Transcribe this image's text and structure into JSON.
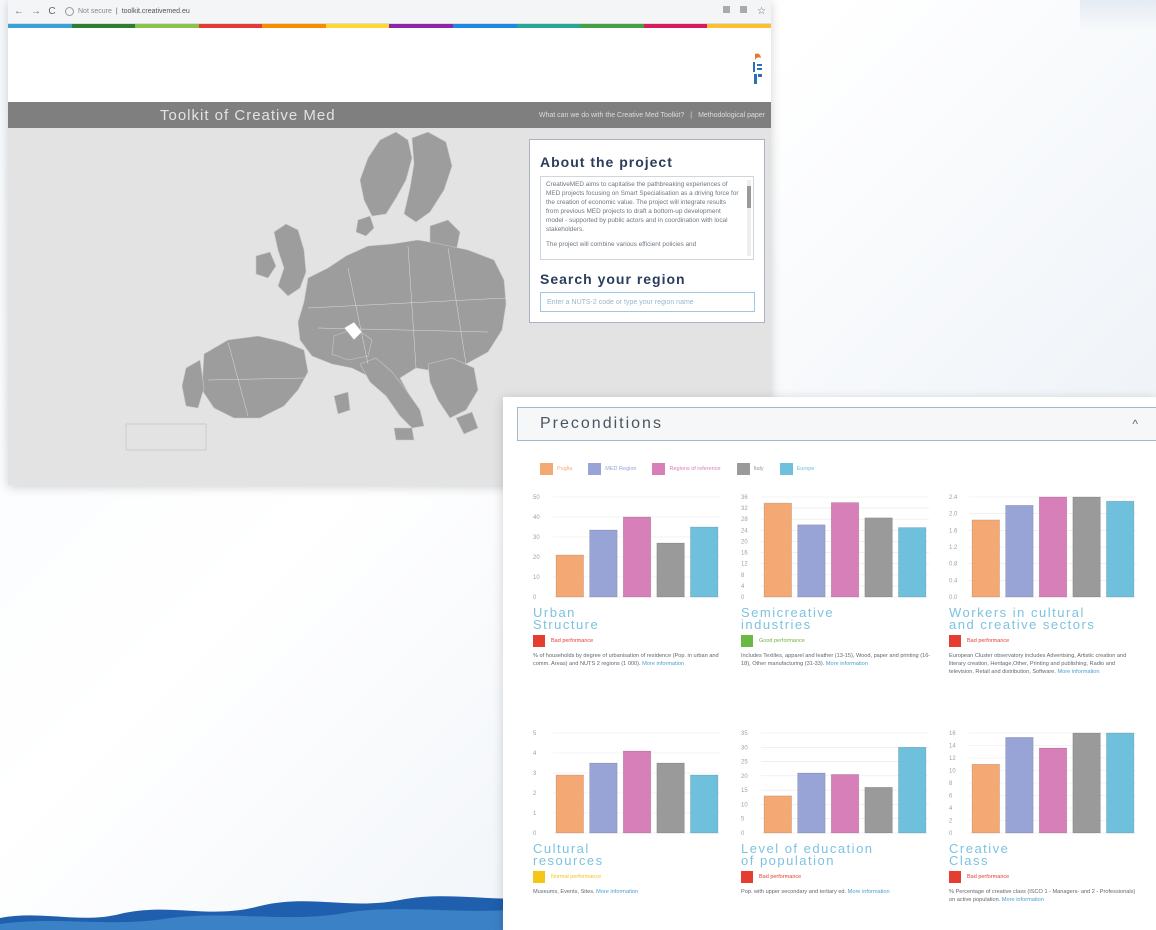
{
  "browser": {
    "security_label": "Not secure",
    "url": "toolkit.creativemed.eu",
    "rainbow_colors": [
      "#3aa0d8",
      "#2e7d32",
      "#8bc34a",
      "#e53935",
      "#fb8c00",
      "#fdd835",
      "#8e24aa",
      "#1e88e5",
      "#26a69a",
      "#43a047",
      "#d81b60",
      "#fbc02d"
    ]
  },
  "site": {
    "title": "Toolkit of Creative Med",
    "nav_items": [
      "What can we do with the Creative Med Toolkit?",
      "Methodological paper"
    ]
  },
  "about": {
    "title": "About the project",
    "text_1": "CreativeMED aims to capitalise the pathbreaking experiences of MED projects focusing on Smart Specialisation as a driving force for the creation of economic value. The project will integrate results from previous MED projects to draft a bottom-up development model - supported by public actors and in coordination with local stakeholders.",
    "text_2": "The project will combine various efficient policies and"
  },
  "search": {
    "title": "Search your region",
    "placeholder": "Enter a NUTS-2 code or type your region name"
  },
  "preconditions": {
    "title": "Preconditions",
    "chevron": "^",
    "legend": [
      {
        "label": "Puglia",
        "color": "#f4a874"
      },
      {
        "label": "MED Region",
        "color": "#98a3d6"
      },
      {
        "label": "Regions of reference",
        "color": "#d77fb9"
      },
      {
        "label": "Italy",
        "color": "#9a9a9a"
      },
      {
        "label": "Europe",
        "color": "#6fc0dc"
      }
    ],
    "performance_colors": {
      "bad": "#e53d30",
      "good": "#6bb844",
      "normal": "#f5c518"
    }
  },
  "chart_data": [
    {
      "type": "bar",
      "title_1": "Urban",
      "title_2": "Structure",
      "categories": [
        "Puglia",
        "MED Region",
        "Regions of reference",
        "Italy",
        "Europe"
      ],
      "values": [
        21,
        33.5,
        40,
        27,
        35
      ],
      "ylim": [
        0,
        50
      ],
      "yticks": [
        "0",
        "10",
        "20",
        "30",
        "40",
        "50"
      ],
      "performance": "Bad performance",
      "performance_level": "bad",
      "description": "% of households by degree of urbanisation of residence (Pop. in urban and comm. Areas) and NUTS 2 regions (1 000).",
      "more": "More information"
    },
    {
      "type": "bar",
      "title_1": "Semicreative",
      "title_2": "industries",
      "categories": [
        "Puglia",
        "MED Region",
        "Regions of reference",
        "Italy",
        "Europe"
      ],
      "values": [
        33.8,
        26,
        34,
        28.5,
        25
      ],
      "ylim": [
        0,
        36
      ],
      "yticks": [
        "0",
        "4",
        "8",
        "12",
        "16",
        "20",
        "24",
        "28",
        "32",
        "36"
      ],
      "performance": "Good performance",
      "performance_level": "good",
      "description": "Includes Textiles, apparel and leather (13-15), Wood, paper and printing (16-18), Other manufacturing (31-33).",
      "more": "More information"
    },
    {
      "type": "bar",
      "title_1": "Workers in cultural",
      "title_2": "and creative sectors",
      "categories": [
        "Puglia",
        "MED Region",
        "Regions of reference",
        "Italy",
        "Europe"
      ],
      "values": [
        1.85,
        2.2,
        2.4,
        2.45,
        2.3
      ],
      "ylim": [
        0,
        2.4
      ],
      "yticks": [
        "0.0",
        "0.4",
        "0.8",
        "1.2",
        "1.6",
        "2.0",
        "2.4"
      ],
      "performance": "Bad performance",
      "performance_level": "bad",
      "description": "European Cluster observatory includes Advertising, Artistic creation and literary creation, Heritage,Other, Printing and publishing, Radio and television, Retail and distribution, Software.",
      "more": "More information"
    },
    {
      "type": "bar",
      "title_1": "Cultural",
      "title_2": "resources",
      "categories": [
        "Puglia",
        "MED Region",
        "Regions of reference",
        "Italy",
        "Europe"
      ],
      "values": [
        2.9,
        3.5,
        4.1,
        3.5,
        2.9
      ],
      "ylim": [
        0,
        5
      ],
      "yticks": [
        "0",
        "1",
        "2",
        "3",
        "4",
        "5"
      ],
      "performance": "Normal performance",
      "performance_level": "normal",
      "description": "Museums, Events, Sites.",
      "more": "More information"
    },
    {
      "type": "bar",
      "title_1": "Level of education",
      "title_2": "of population",
      "categories": [
        "Puglia",
        "MED Region",
        "Regions of reference",
        "Italy",
        "Europe"
      ],
      "values": [
        13,
        21,
        20.5,
        16,
        30
      ],
      "ylim": [
        0,
        35
      ],
      "yticks": [
        "0",
        "5",
        "10",
        "15",
        "20",
        "25",
        "30",
        "35"
      ],
      "performance": "Bad performance",
      "performance_level": "bad",
      "description": "Pop. with upper secondary and tertiary ed.",
      "more": "More information"
    },
    {
      "type": "bar",
      "title_1": "Creative",
      "title_2": "Class",
      "categories": [
        "Puglia",
        "MED Region",
        "Regions of reference",
        "Italy",
        "Europe"
      ],
      "values": [
        11,
        15.3,
        13.6,
        16,
        16
      ],
      "ylim": [
        0,
        16
      ],
      "yticks": [
        "0",
        "2",
        "4",
        "6",
        "8",
        "10",
        "12",
        "14",
        "16"
      ],
      "performance": "Bad performance",
      "performance_level": "bad",
      "description": "% Percentage of creative class (ISCO 1 - Managers- and 2 - Professionals) on active population.",
      "more": "More information"
    }
  ]
}
